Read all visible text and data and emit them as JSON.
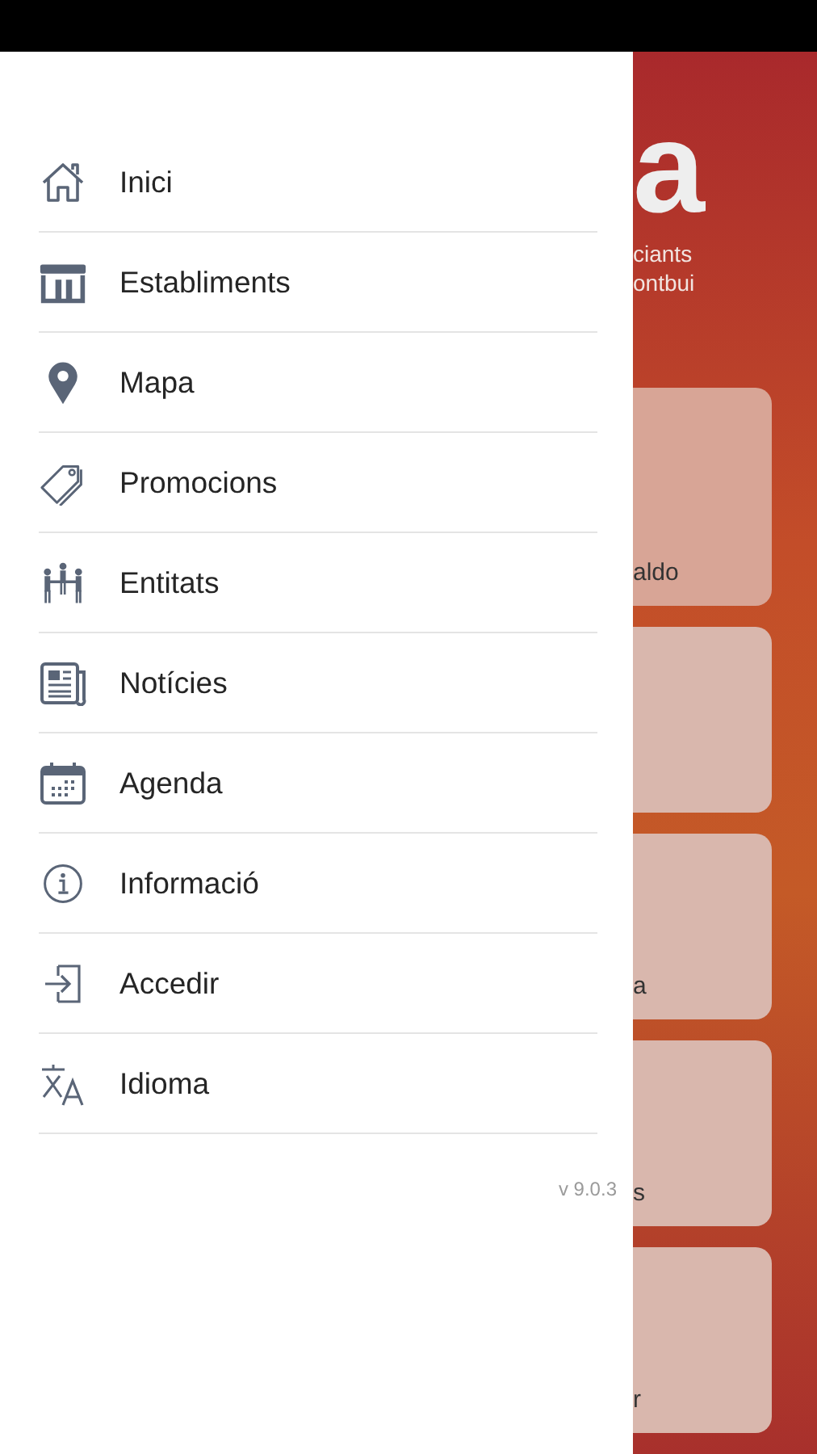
{
  "menu": [
    {
      "label": "Inici"
    },
    {
      "label": "Establiments"
    },
    {
      "label": "Mapa"
    },
    {
      "label": "Promocions"
    },
    {
      "label": "Entitats"
    },
    {
      "label": "Notícies"
    },
    {
      "label": "Agenda"
    },
    {
      "label": "Informació"
    },
    {
      "label": "Accedir"
    },
    {
      "label": "Idioma"
    }
  ],
  "version": "v 9.0.3",
  "background_screen": {
    "logo_letter": "a",
    "subtitle_lines": [
      "ciants",
      "ontbui"
    ],
    "cards": [
      {
        "kind": "labeled",
        "label": "aldo"
      },
      {
        "kind": "blank"
      },
      {
        "kind": "labeled",
        "label": "a"
      },
      {
        "kind": "labeled",
        "label": "s"
      },
      {
        "kind": "labeled",
        "label": "r"
      }
    ]
  }
}
